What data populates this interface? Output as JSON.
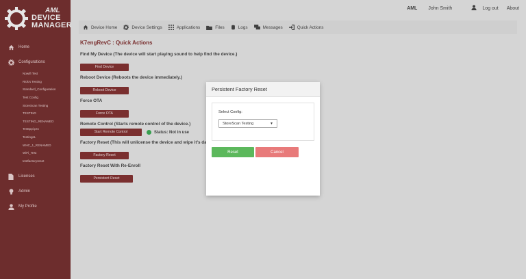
{
  "brand": {
    "line1": "AML",
    "line2": "DEVICE",
    "line3": "MANAGER"
  },
  "topbar": {
    "company": "AML",
    "user": "John Smith",
    "logout": "Log out",
    "about": "About"
  },
  "sidebar": {
    "nav": [
      {
        "label": "Home",
        "icon": "home-icon"
      },
      {
        "label": "Configurations",
        "icon": "gear-icon"
      },
      {
        "label": "Licenses",
        "icon": "document-icon"
      },
      {
        "label": "Admin",
        "icon": "lightbulb-icon"
      },
      {
        "label": "My Profile",
        "icon": "user-icon"
      }
    ],
    "configs": [
      "Nowifi Test",
      "Rick's Testing",
      "Standard_Configuration",
      "Test Config",
      "StoreScan Testing",
      "TESTING",
      "TESTING_RENAMED",
      "Testtppl.pro",
      "TestingsL",
      "WHC_1_RENAMED",
      "WiFi_Test",
      "testfactoryreset"
    ]
  },
  "tabs": [
    {
      "label": "Device Home",
      "icon": "home-icon"
    },
    {
      "label": "Device Settings",
      "icon": "gear-icon"
    },
    {
      "label": "Applications",
      "icon": "grid-icon"
    },
    {
      "label": "Files",
      "icon": "folder-icon"
    },
    {
      "label": "Logs",
      "icon": "log-icon"
    },
    {
      "label": "Messages",
      "icon": "chat-icon"
    },
    {
      "label": "Quick Actions",
      "icon": "signin-icon"
    }
  ],
  "page": {
    "title": "K7engRevC : Quick Actions",
    "sections": [
      {
        "label": "Find My Device (The device will start playing sound to help find the device.)",
        "button": "Find Device"
      },
      {
        "label": "Reboot Device (Reboots the device immediately.)",
        "button": "Reboot Device"
      },
      {
        "label": "Force OTA",
        "button": "Force OTA"
      },
      {
        "label": "Remote Control (Starts remote control of the device.)",
        "button": "Start Remote Control",
        "status": "Status: Not in use"
      },
      {
        "label": "Factory Reset (This will unlicense the device and wipe it's data.)",
        "button": "Factory Reset"
      },
      {
        "label": "Factory Reset With Re-Enroll",
        "button": "Persistent Reset"
      }
    ]
  },
  "modal": {
    "title": "Persistent Factory Reset",
    "select_label": "Select Config:",
    "select_value": "StoreScan Testing",
    "reset": "Reset",
    "cancel": "Cancel"
  },
  "colors": {
    "sidebar": "#6b1d1d",
    "button": "#7a1f1f",
    "reset": "#5cb85c",
    "cancel": "#e87a7a",
    "status": "#28a745"
  }
}
